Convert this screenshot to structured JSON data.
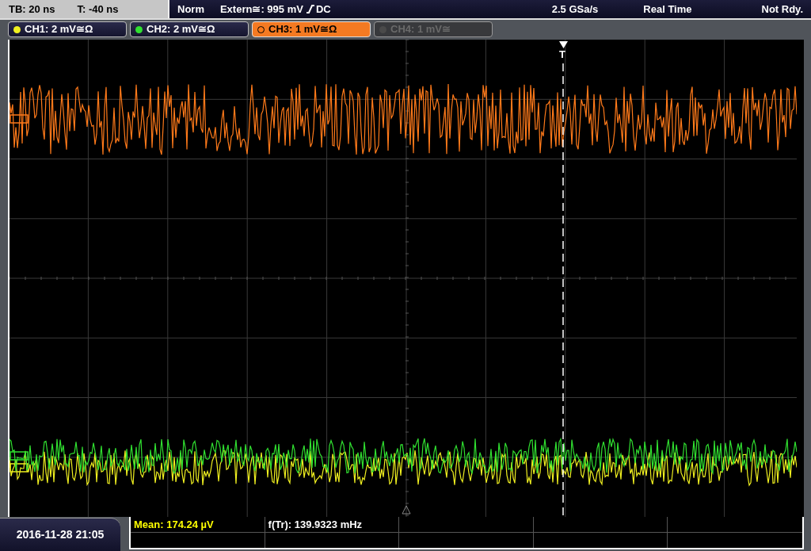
{
  "status_bar": {
    "timebase": "TB: 20 ns",
    "trigger_time": "T: -40 ns",
    "trigger_mode": "Norm",
    "trigger_source": "Extern≅: 995 mV",
    "trigger_coupling": "DC",
    "sample_rate": "2.5 GSa/s",
    "acquisition": "Real Time",
    "state": "Not Rdy."
  },
  "channels": [
    {
      "label": "CH1: 2 mV≅Ω",
      "color": "#f0f020",
      "on": true,
      "selected": false
    },
    {
      "label": "CH2: 2 mV≅Ω",
      "color": "#30e030",
      "on": true,
      "selected": false
    },
    {
      "label": "CH3: 1 mV≅Ω",
      "color": "#ff7a1a",
      "on": true,
      "selected": true
    },
    {
      "label": "CH4: 1 mV≅",
      "color": "#4a4a4a",
      "on": false,
      "selected": false
    }
  ],
  "trigger_marker": {
    "label": "T"
  },
  "measurements": [
    {
      "text": "Mean: 174.24 µV",
      "color": "#ffff00"
    },
    {
      "text": "f(Tr): 139.9323 mHz",
      "color": "#ffffff"
    }
  ],
  "date_time": "2016-11-28 21:05"
}
